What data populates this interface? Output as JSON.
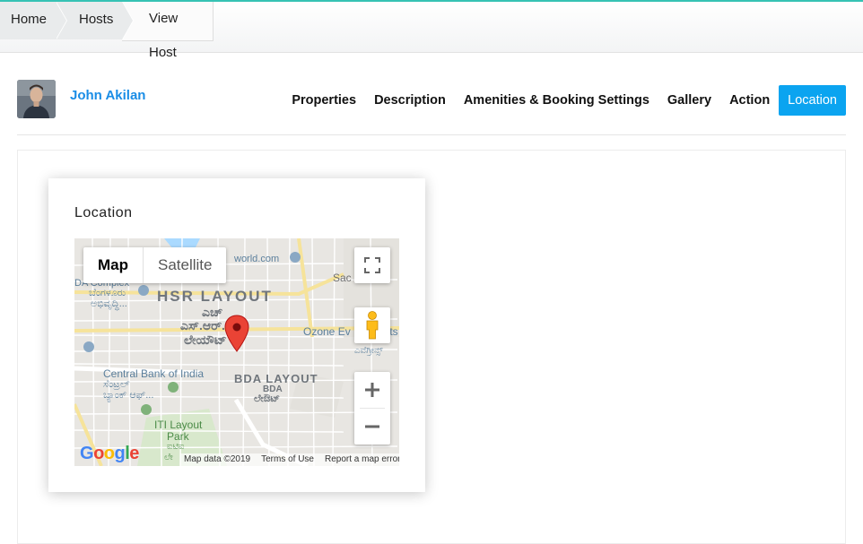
{
  "breadcrumb": {
    "home": "Home",
    "hosts": "Hosts",
    "current": "View Host"
  },
  "host": {
    "name": "John Akilan"
  },
  "tabs": [
    {
      "label": "Properties"
    },
    {
      "label": "Description"
    },
    {
      "label": "Amenities & Booking Settings"
    },
    {
      "label": "Gallery"
    },
    {
      "label": "Action"
    },
    {
      "label": "Location"
    }
  ],
  "location": {
    "title": "Location",
    "map": {
      "type_map": "Map",
      "type_satellite": "Satellite",
      "labels": {
        "hsr": "HSR LAYOUT",
        "hsr_kn1": "ಎಚ್",
        "hsr_kn2": "ಎಸ್.ಆರ್.",
        "hsr_kn3": "ಲೇಯೌಟ್",
        "complex": "DA Complex",
        "complex_kn1": "ಬೆಂಗಳೂರು",
        "complex_kn2": "ಅಭಿವೃದ್ಧಿ...",
        "world": "world.com",
        "sac": "Sac",
        "ozone": "Ozone Ev",
        "ozone2": "ents",
        "ozone_kn": "ಎವೆಗ್ರೀನ್ಸ್",
        "cbi": "Central Bank of India",
        "cbi_kn1": "ಸೆಂಟ್ರಲ್",
        "cbi_kn2": "ಬ್ಯಾಂಕ್ ಆಫ್...",
        "bda": "BDA LAYOUT",
        "bda2": "BDA",
        "bda_kn": "ಲೇಔಟ್",
        "iti1": "ITI Layout",
        "iti2": "Park",
        "iti_kn1": "ಐಟಿಐ",
        "iti_kn2": "ಲೇ"
      },
      "footer": {
        "data": "Map data ©2019",
        "terms": "Terms of Use",
        "report": "Report a map error"
      },
      "logo": "Google"
    }
  },
  "colors": {
    "accent": "#0ba4f0",
    "link": "#1a8de6",
    "topline": "#36c2b4",
    "pin": "#ea4335"
  }
}
